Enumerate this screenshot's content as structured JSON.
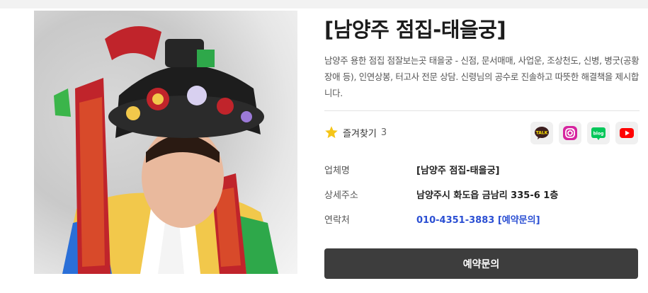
{
  "profile": {
    "title": "[남양주 점집-태을궁]",
    "description": "남양주 용한 점집 점잘보는곳 태을궁 - 신점, 문서매매, 사업운, 조상천도, 신병, 병굿(공황장애 등), 인연상봉, 터고사 전문 상담. 신령님의 공수로 진솔하고 따뜻한 해결책을 제시합니다.",
    "favorite_label": "즐겨찾기",
    "favorite_count": "3"
  },
  "sns": [
    {
      "name": "kakaotalk-icon",
      "text": "TALK",
      "color": "#3c1e1e",
      "bg": "#fee500"
    },
    {
      "name": "instagram-icon",
      "color": "#c13584"
    },
    {
      "name": "blog-icon",
      "text": "blog",
      "color": "#03c75a"
    },
    {
      "name": "youtube-icon",
      "color": "#ff0000"
    }
  ],
  "details": {
    "business_label": "업체명",
    "business_value": "[남양주 점집-태을궁]",
    "address_label": "상세주소",
    "address_value": "남양주시 화도읍 금남리 335-6 1층",
    "contact_label": "연락처",
    "contact_value": "010-4351-3883 [예약문의]"
  },
  "reserve_button": "예약문의",
  "colors": {
    "button_bg": "#3d3d3d",
    "link": "#2b4fd3",
    "star": "#f5c518"
  }
}
